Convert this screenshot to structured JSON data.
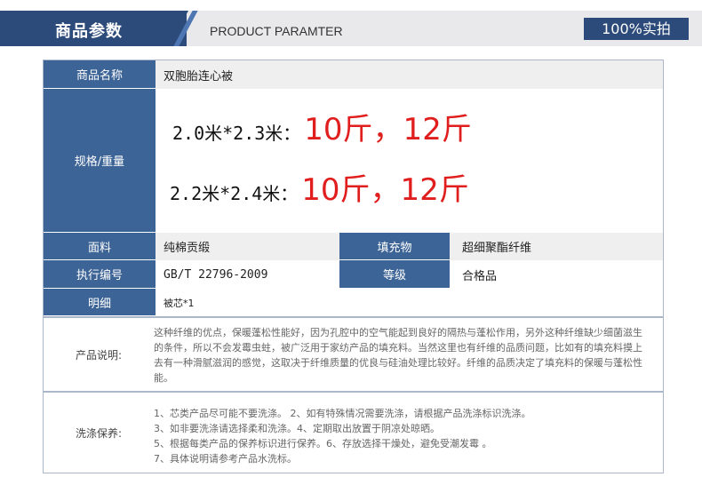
{
  "header": {
    "title": "商品参数",
    "subtitle_en": "PRODUCT PARAMTER",
    "badge": "100%实拍"
  },
  "rows": {
    "name": {
      "label": "商品名称",
      "value": "双胞胎连心被"
    },
    "spec": {
      "label": "规格/重量",
      "line1_size": "2.0米*2.3米：",
      "line1_weight": "10斤，12斤",
      "line2_size": "2.2米*2.4米：",
      "line2_weight": "10斤，12斤"
    },
    "fabric": {
      "label": "面料",
      "value": "纯棉贡缎",
      "label2": "填充物",
      "value2": "超细聚酯纤维"
    },
    "standard": {
      "label": "执行编号",
      "value": "GB/T 22796-2009",
      "label2": "等级",
      "value2": "合格品"
    },
    "detail": {
      "label": "明细",
      "value": "被芯*1"
    }
  },
  "description": {
    "label": "产品说明:",
    "text": "这种纤维的优点，保暖蓬松性能好，因为孔腔中的空气能起到良好的隔热与蓬松作用，另外这种纤维缺少细菌滋生的条件，所以不会发霉虫蛀，被广泛用于家纺产品的填充料。当然这里也有纤维的品质问题，比如有的填充料摸上去有一种滑腻滋润的感觉，这取决于纤维质量的优良与硅油处理比较好。纤维的品质决定了填充料的保暖与蓬松性能。"
  },
  "care": {
    "label": "洗涤保养:",
    "lines": [
      "1、芯类产品尽可能不要洗涤。 2、如有特殊情况需要洗涤，请根据产品洗涤标识洗涤。",
      "3、如非要洗涤请选择柔和洗涤。4、定期取出放置于阴凉处晾晒。",
      "5、根据每类产品的保养标识进行保养。6、存放选择干燥处，避免受潮发霉 。",
      "7、具体说明请参考产品水洗标。"
    ]
  },
  "colors": {
    "navy": "#2c4a7a",
    "label_blue": "#3d6496",
    "weight_red": "#e11e1e"
  }
}
